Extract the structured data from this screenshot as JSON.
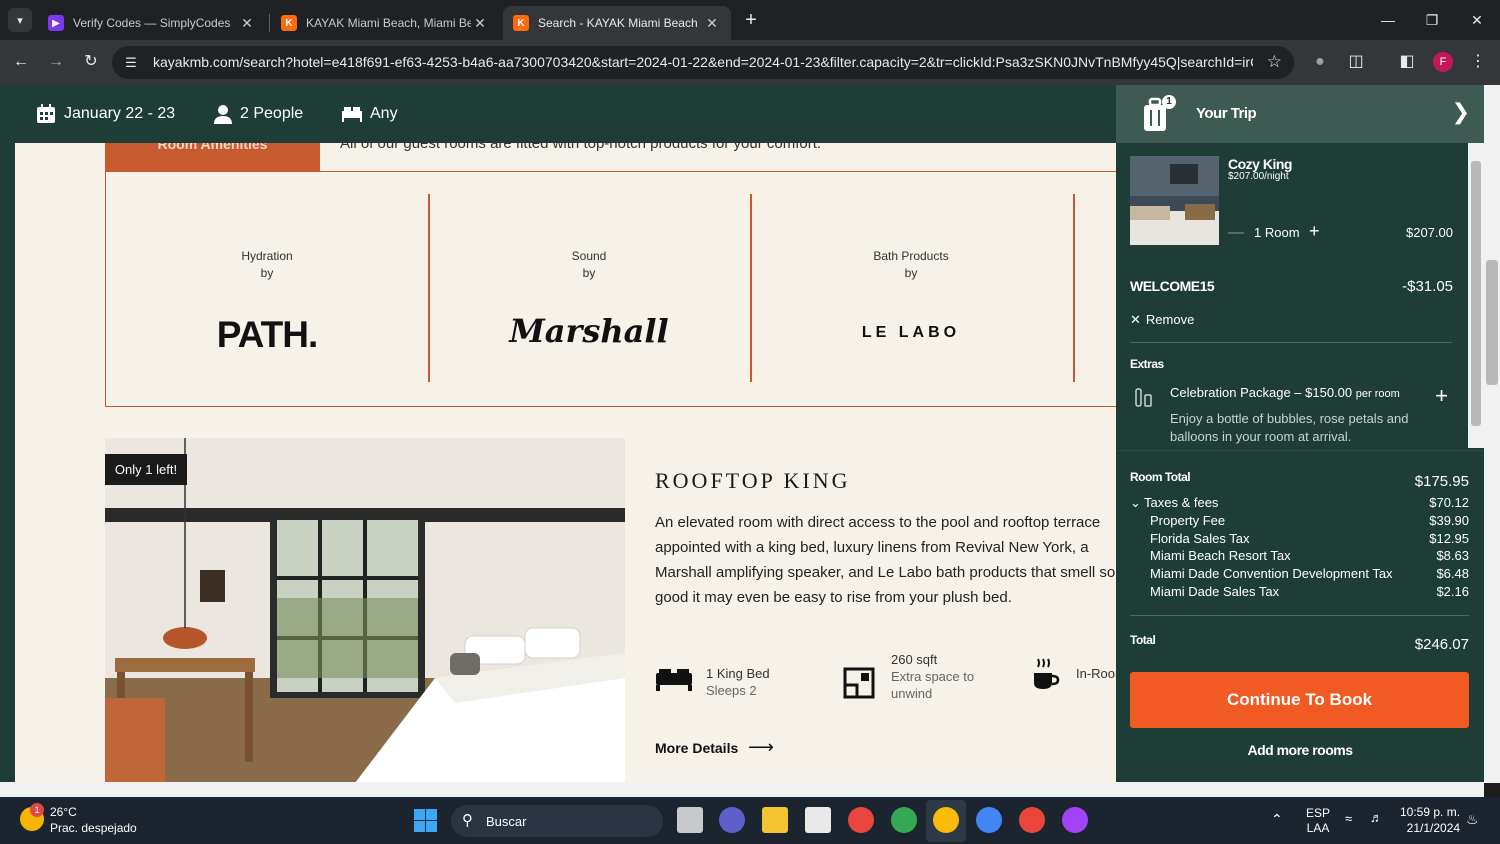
{
  "browser": {
    "tabs": [
      {
        "title": "Verify Codes — SimplyCodes",
        "favicon_color": "#7c3aed",
        "favicon_letter": ""
      },
      {
        "title": "KAYAK Miami Beach, Miami Bea",
        "favicon_color": "#ff690f",
        "favicon_letter": "K"
      },
      {
        "title": "Search - KAYAK Miami Beach",
        "favicon_color": "#ff690f",
        "favicon_letter": "K"
      }
    ],
    "url": "kayakmb.com/search?hotel=e418f691-ef63-4253-b4a6-aa7300703420&start=2024-01-22&end=2024-01-23&filter.capacity=2&tr=clickId:Psa3zSKN0JNvTnBMfyy45Q|searchId=irCEI...",
    "profile_letter": "F"
  },
  "header": {
    "dates": "January 22 - 23",
    "people": "2 People",
    "beds": "Any"
  },
  "amenities": {
    "tab_label": "Room Amenities",
    "intro": "All of our guest rooms are fitted with top-notch products for your comfort.",
    "items": [
      {
        "label": "Hydration",
        "by": "by",
        "brand": "PATH."
      },
      {
        "label": "Sound",
        "by": "by",
        "brand": "Marshall"
      },
      {
        "label": "Bath Products",
        "by": "by",
        "brand": "LE LABO"
      }
    ]
  },
  "room": {
    "badge": "Only 1 left!",
    "title": "ROOFTOP KING",
    "description": [
      "An elevated room with direct access to the pool and rooftop terrace",
      "appointed with a king bed, luxury linens from Revival New York, a",
      "Marshall amplifying speaker, and Le Labo bath products that smell so",
      "good it may even be easy to rise from your plush bed."
    ],
    "features": [
      {
        "line1": "1 King Bed",
        "line2": "Sleeps 2",
        "line3": ""
      },
      {
        "line1": "260 sqft",
        "line2": "Extra space to",
        "line3": "unwind"
      },
      {
        "line1": "In-Room",
        "line2": "",
        "line3": ""
      }
    ],
    "more_details": "More Details"
  },
  "trip": {
    "title": "Your Trip",
    "count": "1",
    "item": {
      "name": "Cozy King",
      "rate": "$207.00/night",
      "rooms": "1 Room",
      "price": "$207.00"
    },
    "promo": {
      "code": "WELCOME15",
      "amount": "-$31.05",
      "remove": "Remove"
    },
    "extras": {
      "heading": "Extras",
      "name": "Celebration Package – $150.00",
      "unit": "per room",
      "desc_line1": "Enjoy a bottle of bubbles, rose petals and",
      "desc_line2": "balloons in your room at arrival."
    },
    "room_total_label": "Room Total",
    "room_total": "$175.95",
    "taxes_label": "Taxes & fees",
    "taxes_total": "$70.12",
    "taxes": [
      {
        "name": "Property Fee",
        "amount": "$39.90"
      },
      {
        "name": "Florida Sales Tax",
        "amount": "$12.95"
      },
      {
        "name": "Miami Beach Resort Tax",
        "amount": "$8.63"
      },
      {
        "name": "Miami Dade Convention Development Tax",
        "amount": "$6.48"
      },
      {
        "name": "Miami Dade Sales Tax",
        "amount": "$2.16"
      }
    ],
    "total_label": "Total",
    "total": "$246.07",
    "cta": "Continue To Book",
    "add_rooms": "Add more rooms"
  },
  "taskbar": {
    "weather_temp": "26°C",
    "weather_desc": "Prac. despejado",
    "weather_badge": "1",
    "search": "Buscar",
    "lang1": "ESP",
    "lang2": "LAA",
    "time": "10:59 p. m.",
    "date": "21/1/2024"
  },
  "colors": {
    "brand_green": "#1e3d36",
    "accent_orange": "#f15a22",
    "amenity_orange": "#c75a2e",
    "cream": "#f6f2e9"
  }
}
